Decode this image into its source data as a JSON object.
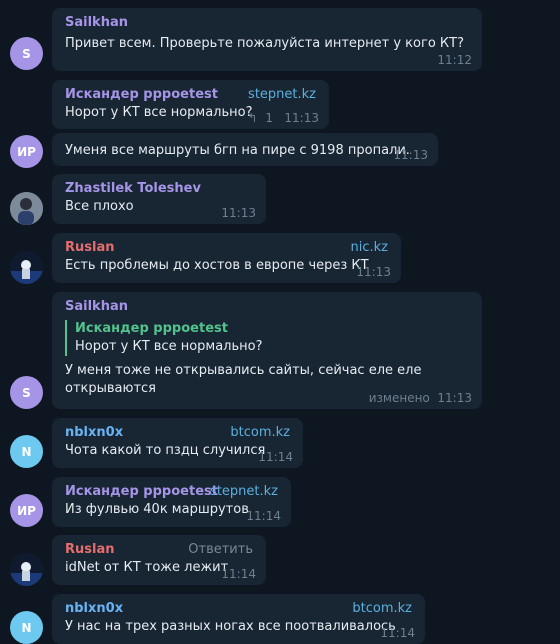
{
  "messages": [
    {
      "sender": "Sailkhan",
      "text": "Привет всем. Проверьте пожалуйста интернет у кого КТ?",
      "time": "11:12",
      "avatar": "S"
    },
    {
      "sender": "Искандер pppoetest",
      "tag": "stepnet.kz",
      "text": "Норот у КТ все нормально?",
      "replies": "1",
      "time": "11:13"
    },
    {
      "text": "Уменя все маршруты бгп на пире с 9198 пропали.",
      "time": "11:13",
      "avatar": "ИР"
    },
    {
      "sender": "Zhastilek Toleshev",
      "text": "Все плохо",
      "time": "11:13"
    },
    {
      "sender": "Ruslan",
      "tag": "nic.kz",
      "text": "Есть проблемы до хостов в европе через КТ",
      "time": "11:13"
    },
    {
      "sender": "Sailkhan",
      "reply_name": "Искандер pppoetest",
      "reply_text": "Норот у КТ все нормально?",
      "text_line1": "У меня тоже не открывались сайты, сейчас еле еле",
      "text_line2": "открываются",
      "edited": "изменено",
      "time": "11:13",
      "avatar": "S"
    },
    {
      "sender": "nblxn0x",
      "tag": "btcom.kz",
      "text": "Чота какой то пздц случился",
      "time": "11:14",
      "avatar": "N"
    },
    {
      "sender": "Искандер pppoetest",
      "tag": "stepnet.kz",
      "text": "Из фулвью 40к маршрутов",
      "time": "11:14",
      "avatar": "ИР"
    },
    {
      "sender": "Ruslan",
      "tag": "Ответить",
      "text": "idNet от КТ тоже лежит",
      "time": "11:14"
    },
    {
      "sender": "nblxn0x",
      "tag": "btcom.kz",
      "text": "У нас на трех разных ногах все поотваливалось",
      "time": "11:14",
      "avatar": "N"
    }
  ],
  "colors": {
    "background": "#0e1621",
    "bubble": "#182533",
    "link": "#5cb0de"
  }
}
